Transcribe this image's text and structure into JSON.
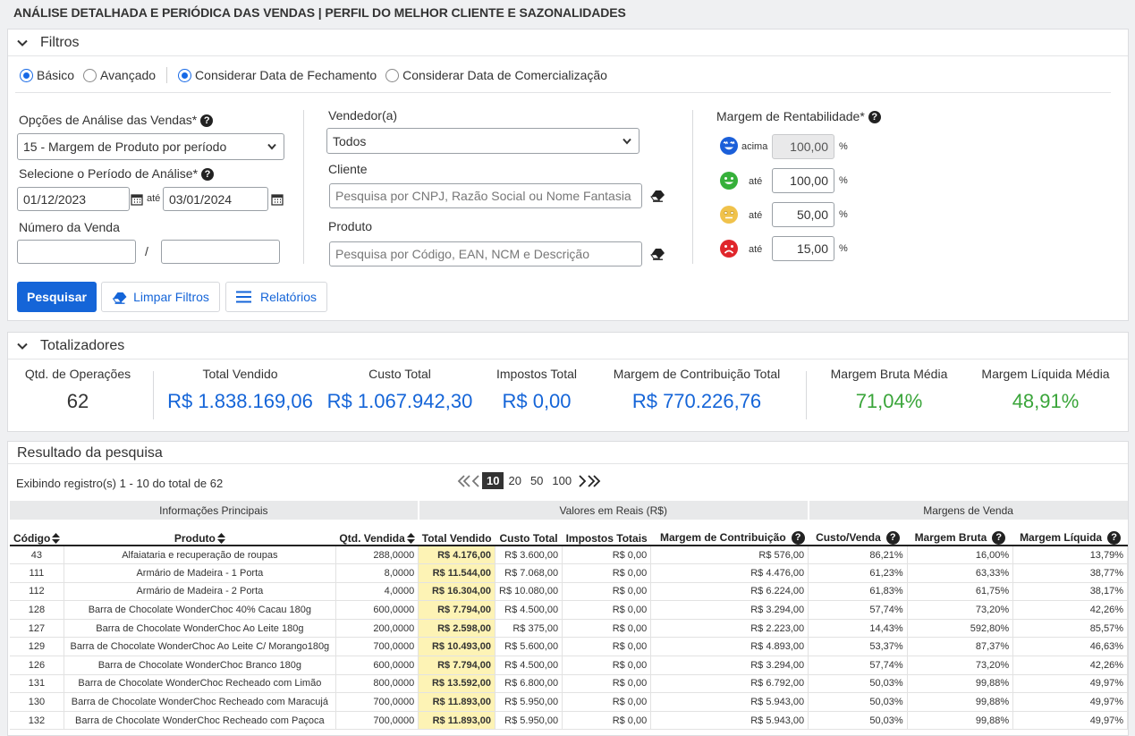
{
  "title": "ANÁLISE DETALHADA E PERIÓDICA DAS VENDAS | PERFIL DO MELHOR CLIENTE E SAZONALIDADES",
  "filters": {
    "header": "Filtros",
    "mode_basic": "Básico",
    "mode_advanced": "Avançado",
    "date_closing": "Considerar Data de Fechamento",
    "date_commercial": "Considerar Data de Comercialização",
    "analysis_label": "Opções de Análise das Vendas*",
    "analysis_value": "15 - Margem de Produto por período",
    "period_label": "Selecione o Período de Análise*",
    "date_from": "01/12/2023",
    "date_to": "03/01/2024",
    "ate": "até",
    "sale_number_label": "Número da Venda",
    "slash": "/",
    "seller_label": "Vendedor(a)",
    "seller_value": "Todos",
    "client_label": "Cliente",
    "client_placeholder": "Pesquisa por CNPJ, Razão Social ou Nome Fantasia",
    "product_label": "Produto",
    "product_placeholder": "Pesquisa por Código, EAN, NCM e Descrição",
    "margin_label": "Margem de Rentabilidade*",
    "margins": [
      {
        "qualifier": "acima",
        "value": "100,00",
        "unit": "%"
      },
      {
        "qualifier": "até",
        "value": "100,00",
        "unit": "%"
      },
      {
        "qualifier": "até",
        "value": "50,00",
        "unit": "%"
      },
      {
        "qualifier": "até",
        "value": "15,00",
        "unit": "%"
      }
    ],
    "search_btn": "Pesquisar",
    "clear_btn": "Limpar Filtros",
    "reports_btn": "Relatórios"
  },
  "totals": {
    "header": "Totalizadores",
    "items": [
      {
        "label": "Qtd. de Operações",
        "value": "62"
      },
      {
        "label": "Total Vendido",
        "value": "R$ 1.838.169,06"
      },
      {
        "label": "Custo Total",
        "value": "R$ 1.067.942,30"
      },
      {
        "label": "Impostos Total",
        "value": "R$ 0,00"
      },
      {
        "label": "Margem de Contribuição Total",
        "value": "R$ 770.226,76"
      },
      {
        "label": "Margem Bruta Média",
        "value": "71,04%"
      },
      {
        "label": "Margem Líquida Média",
        "value": "48,91%"
      }
    ]
  },
  "results": {
    "header": "Resultado da pesquisa",
    "showing": "Exibindo registro(s) 1 - 10 do total de 62",
    "page_sizes": [
      "10",
      "20",
      "50",
      "100"
    ],
    "groups": [
      "Informações Principais",
      "Valores em Reais (R$)",
      "Margens de Venda"
    ],
    "columns": [
      "Código",
      "Produto",
      "Qtd. Vendida",
      "Total Vendido",
      "Custo Total",
      "Impostos Totais",
      "Margem de Contribuição",
      "Custo/Venda",
      "Margem Bruta",
      "Margem Líquida"
    ],
    "rows": [
      [
        "43",
        "Alfaiataria e recuperação de roupas",
        "288,0000",
        "R$ 4.176,00",
        "R$ 3.600,00",
        "R$ 0,00",
        "R$ 576,00",
        "86,21%",
        "16,00%",
        "13,79%"
      ],
      [
        "111",
        "Armário de Madeira - 1 Porta",
        "8,0000",
        "R$ 11.544,00",
        "R$ 7.068,00",
        "R$ 0,00",
        "R$ 4.476,00",
        "61,23%",
        "63,33%",
        "38,77%"
      ],
      [
        "112",
        "Armário de Madeira - 2 Porta",
        "4,0000",
        "R$ 16.304,00",
        "R$ 10.080,00",
        "R$ 0,00",
        "R$ 6.224,00",
        "61,83%",
        "61,75%",
        "38,17%"
      ],
      [
        "128",
        "Barra de Chocolate WonderChoc 40% Cacau 180g",
        "600,0000",
        "R$ 7.794,00",
        "R$ 4.500,00",
        "R$ 0,00",
        "R$ 3.294,00",
        "57,74%",
        "73,20%",
        "42,26%"
      ],
      [
        "127",
        "Barra de Chocolate WonderChoc Ao Leite 180g",
        "200,0000",
        "R$ 2.598,00",
        "R$ 375,00",
        "R$ 0,00",
        "R$ 2.223,00",
        "14,43%",
        "592,80%",
        "85,57%"
      ],
      [
        "129",
        "Barra de Chocolate WonderChoc Ao Leite C/ Morango180g",
        "700,0000",
        "R$ 10.493,00",
        "R$ 5.600,00",
        "R$ 0,00",
        "R$ 4.893,00",
        "53,37%",
        "87,37%",
        "46,63%"
      ],
      [
        "126",
        "Barra de Chocolate WonderChoc Branco 180g",
        "600,0000",
        "R$ 7.794,00",
        "R$ 4.500,00",
        "R$ 0,00",
        "R$ 3.294,00",
        "57,74%",
        "73,20%",
        "42,26%"
      ],
      [
        "131",
        "Barra de Chocolate WonderChoc Recheado com Limão",
        "800,0000",
        "R$ 13.592,00",
        "R$ 6.800,00",
        "R$ 0,00",
        "R$ 6.792,00",
        "50,03%",
        "99,88%",
        "49,97%"
      ],
      [
        "130",
        "Barra de Chocolate WonderChoc Recheado com Maracujá",
        "700,0000",
        "R$ 11.893,00",
        "R$ 5.950,00",
        "R$ 0,00",
        "R$ 5.943,00",
        "50,03%",
        "99,88%",
        "49,97%"
      ],
      [
        "132",
        "Barra de Chocolate WonderChoc Recheado com Paçoca",
        "700,0000",
        "R$ 11.893,00",
        "R$ 5.950,00",
        "R$ 0,00",
        "R$ 5.943,00",
        "50,03%",
        "99,88%",
        "49,97%"
      ]
    ]
  },
  "icons": [
    "chevron-down-icon",
    "help-icon",
    "calendar-icon",
    "eraser-icon",
    "menu-icon",
    "smiley-blue-icon",
    "smiley-green-icon",
    "smiley-yellow-icon",
    "smiley-red-icon",
    "sort-icon",
    "first-page-icon",
    "prev-page-icon",
    "next-page-icon",
    "last-page-icon"
  ],
  "colors": {
    "primary": "#1565d8",
    "green": "#3aa53a",
    "highlight": "#fdf3b5"
  }
}
